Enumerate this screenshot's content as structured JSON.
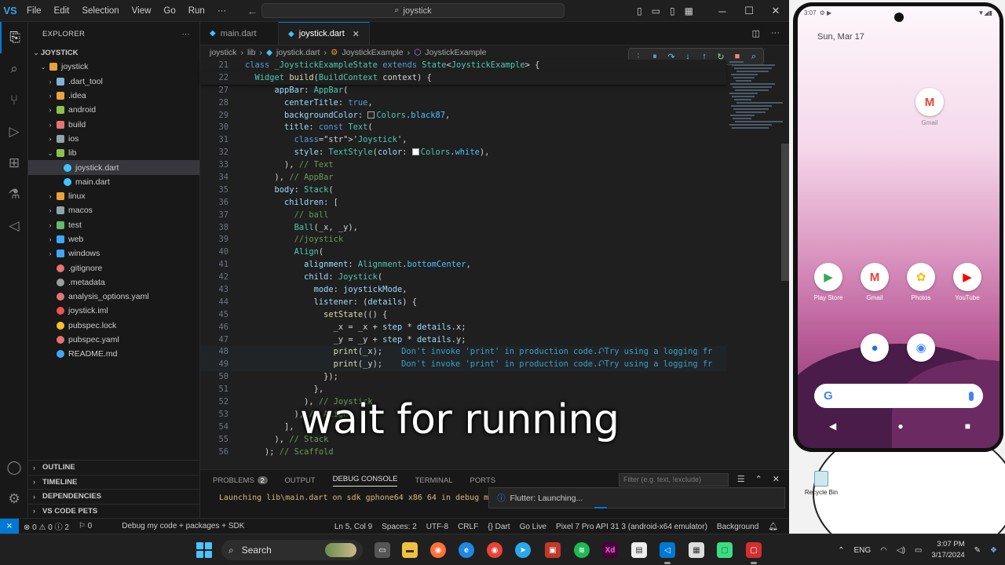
{
  "vscode": {
    "logo": "VS",
    "menu": [
      "File",
      "Edit",
      "Selection",
      "View",
      "Go",
      "Run",
      "···"
    ],
    "command_center": "joystick",
    "activity": [
      "explorer-icon",
      "search-icon",
      "source-control-icon",
      "run-debug-icon",
      "extensions-icon",
      "testing-icon",
      "flutter-icon"
    ],
    "explorer": {
      "header": "EXPLORER",
      "root": "JOYSTICK",
      "items": [
        {
          "name": "joystick",
          "depth": 1,
          "type": "folder-open",
          "color": "#e8a33a"
        },
        {
          "name": ".dart_tool",
          "depth": 2,
          "type": "folder",
          "color": "#7fb3d5"
        },
        {
          "name": ".idea",
          "depth": 2,
          "type": "folder",
          "color": "#e8a33a"
        },
        {
          "name": "android",
          "depth": 2,
          "type": "folder",
          "color": "#8bc34a"
        },
        {
          "name": "build",
          "depth": 2,
          "type": "folder",
          "color": "#e57373"
        },
        {
          "name": "ios",
          "depth": 2,
          "type": "folder",
          "color": "#90a4ae"
        },
        {
          "name": "lib",
          "depth": 2,
          "type": "folder-open",
          "color": "#8bc34a"
        },
        {
          "name": "joystick.dart",
          "depth": 3,
          "type": "file",
          "color": "#40c4ff"
        },
        {
          "name": "main.dart",
          "depth": 3,
          "type": "file",
          "color": "#40c4ff"
        },
        {
          "name": "linux",
          "depth": 2,
          "type": "folder",
          "color": "#e8a33a"
        },
        {
          "name": "macos",
          "depth": 2,
          "type": "folder",
          "color": "#90a4ae"
        },
        {
          "name": "test",
          "depth": 2,
          "type": "folder",
          "color": "#66bb6a"
        },
        {
          "name": "web",
          "depth": 2,
          "type": "folder",
          "color": "#42a5f5"
        },
        {
          "name": "windows",
          "depth": 2,
          "type": "folder",
          "color": "#42a5f5"
        },
        {
          "name": ".gitignore",
          "depth": 2,
          "type": "file",
          "color": "#e57373"
        },
        {
          "name": ".metadata",
          "depth": 2,
          "type": "file",
          "color": "#9e9e9e"
        },
        {
          "name": "analysis_options.yaml",
          "depth": 2,
          "type": "file",
          "color": "#e57373"
        },
        {
          "name": "joystick.iml",
          "depth": 2,
          "type": "file",
          "color": "#ef5350"
        },
        {
          "name": "pubspec.lock",
          "depth": 2,
          "type": "file",
          "color": "#fbc02d"
        },
        {
          "name": "pubspec.yaml",
          "depth": 2,
          "type": "file",
          "color": "#e57373"
        },
        {
          "name": "README.md",
          "depth": 2,
          "type": "file",
          "color": "#42a5f5"
        }
      ],
      "selected": "joystick.dart",
      "sections": [
        "OUTLINE",
        "TIMELINE",
        "DEPENDENCIES",
        "VS CODE PETS"
      ]
    },
    "tabs": [
      {
        "label": "main.dart",
        "active": false
      },
      {
        "label": "joystick.dart",
        "active": true
      }
    ],
    "breadcrumb": [
      "joystick",
      "lib",
      "joystick.dart",
      "JoystickExample",
      "JoystickExample"
    ],
    "editor_lines": [
      {
        "n": "21",
        "text": "class _JoystickExampleState extends State<JoystickExample> {",
        "sticky": true
      },
      {
        "n": "22",
        "text": "  Widget build(BuildContext context) {",
        "sticky": true
      },
      {
        "n": "27",
        "text": "      appBar: AppBar("
      },
      {
        "n": "28",
        "text": "        centerTitle: true,"
      },
      {
        "n": "29",
        "text": "        backgroundColor: Colors.black87,"
      },
      {
        "n": "30",
        "text": "        title: const Text("
      },
      {
        "n": "31",
        "text": "          'Joystick',"
      },
      {
        "n": "32",
        "text": "          style: TextStyle(color: Colors.white),"
      },
      {
        "n": "33",
        "text": "        ), // Text"
      },
      {
        "n": "34",
        "text": "      ), // AppBar"
      },
      {
        "n": "35",
        "text": "      body: Stack("
      },
      {
        "n": "36",
        "text": "        children: ["
      },
      {
        "n": "37",
        "text": "          // ball"
      },
      {
        "n": "38",
        "text": "          Ball(_x, _y),"
      },
      {
        "n": "39",
        "text": "          //joystick"
      },
      {
        "n": "40",
        "text": "          Align("
      },
      {
        "n": "41",
        "text": "            alignment: Alignment.bottomCenter,"
      },
      {
        "n": "42",
        "text": "            child: Joystick("
      },
      {
        "n": "43",
        "text": "              mode: joystickMode,"
      },
      {
        "n": "44",
        "text": "              listener: (details) {"
      },
      {
        "n": "45",
        "text": "                setState(() {"
      },
      {
        "n": "46",
        "text": "                  _x = _x + step * details.x;"
      },
      {
        "n": "47",
        "text": "                  _y = _y + step * details.y;"
      },
      {
        "n": "48",
        "text": "                  print(_x);",
        "hint": "Don't invoke 'print' in production code.⮏Try using a logging fr"
      },
      {
        "n": "49",
        "text": "                  print(_y);",
        "hint": "Don't invoke 'print' in production code.⮏Try using a logging fr"
      },
      {
        "n": "50",
        "text": "                });"
      },
      {
        "n": "51",
        "text": "              },"
      },
      {
        "n": "52",
        "text": "            ), // Joystick"
      },
      {
        "n": "53",
        "text": "          ), // Align"
      },
      {
        "n": "54",
        "text": "        ],"
      },
      {
        "n": "55",
        "text": "      ), // Stack"
      },
      {
        "n": "56",
        "text": "    ); // Scaffold"
      }
    ],
    "caption": "wait for running",
    "panel": {
      "tabs": [
        "PROBLEMS",
        "OUTPUT",
        "DEBUG CONSOLE",
        "TERMINAL",
        "PORTS"
      ],
      "active_tab": "DEBUG CONSOLE",
      "problems_count": "2",
      "filter_placeholder": "Filter (e.g. text, !exclude)",
      "output": "Launching lib\\main.dart on sdk gphone64 x86 64 in debug mode..."
    },
    "toast": "Flutter: Launching...",
    "status": {
      "left": [
        "⊗ 0 ⚠ 0 ⓘ 2",
        "⚐ 0",
        "Debug my code + packages + SDK"
      ],
      "right": [
        "Ln 5, Col 9",
        "Spaces: 2",
        "UTF-8",
        "CRLF",
        "{} Dart",
        "Go Live",
        "Pixel 7 Pro API 31 3 (android-x64 emulator)",
        "Background"
      ]
    }
  },
  "phone": {
    "time": "3:07",
    "date": "Sun, Mar 17",
    "apps": [
      {
        "label": "Gmail",
        "glyph": "M",
        "color": "#ea4335"
      },
      {
        "label": "Play Store",
        "glyph": "▶",
        "color": "#34a853"
      },
      {
        "label": "Gmail",
        "glyph": "M",
        "color": "#ea4335"
      },
      {
        "label": "Photos",
        "glyph": "✿",
        "color": "#fbbc05"
      },
      {
        "label": "YouTube",
        "glyph": "▶",
        "color": "#ff0000"
      },
      {
        "label": "Messages",
        "glyph": "●",
        "color": "#1a73e8"
      },
      {
        "label": "Chrome",
        "glyph": "◉",
        "color": "#4285f4"
      }
    ],
    "search_glyph": "G",
    "nav": [
      "◀",
      "●",
      "■"
    ]
  },
  "desktop": {
    "recycle_bin": "Recycle Bin"
  },
  "taskbar": {
    "search": "Search",
    "lang": "ENG",
    "time": "3:07 PM",
    "date": "3/17/2024"
  }
}
